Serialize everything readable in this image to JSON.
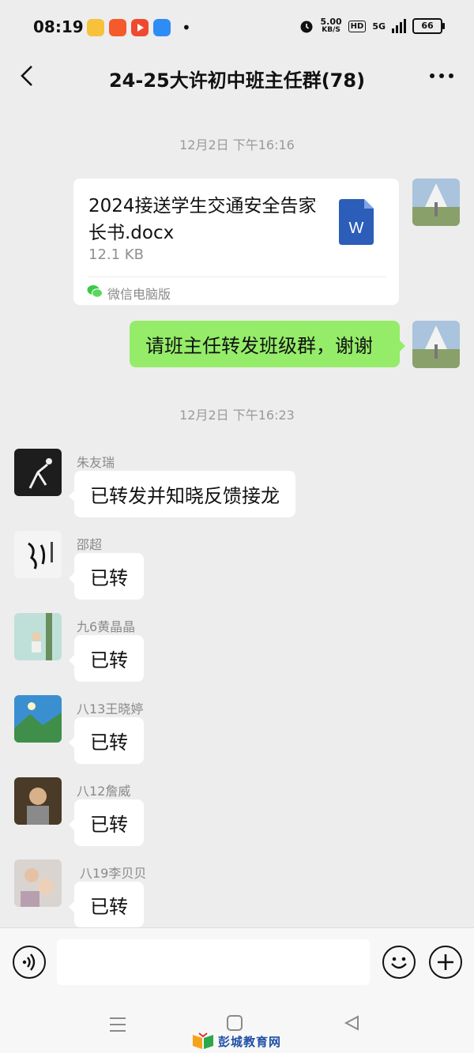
{
  "status_bar": {
    "time": "08:19",
    "net_speed_value": "5.00",
    "net_speed_unit": "KB/S",
    "hd_label": "HD",
    "network_label": "5G",
    "battery_level": "66"
  },
  "nav": {
    "title": "24-25大许初中班主任群(78)"
  },
  "messages": {
    "ts1": "12月2日 下午16:16",
    "file": {
      "name": "2024接送学生交通安全告家长书.docx",
      "size": "12.1 KB",
      "source": "微信电脑版",
      "icon_letter": "W"
    },
    "my_text": "请班主任转发班级群，谢谢",
    "ts2": "12月2日 下午16:23",
    "replies": [
      {
        "name": "朱友瑞",
        "text": "已转发并知晓反馈接龙"
      },
      {
        "name": "邵超",
        "text": "已转"
      },
      {
        "name": "九6黄晶晶",
        "text": "已转"
      },
      {
        "name": "八13王晓婷",
        "text": "已转"
      },
      {
        "name": "八12詹威",
        "text": "已转"
      },
      {
        "name": "八19李贝贝",
        "text": "已转"
      }
    ]
  },
  "watermark": {
    "text": "彭城教育网"
  },
  "colors": {
    "my_bubble": "#95ec69",
    "background": "#ededed",
    "word_blue": "#2b5db9"
  }
}
